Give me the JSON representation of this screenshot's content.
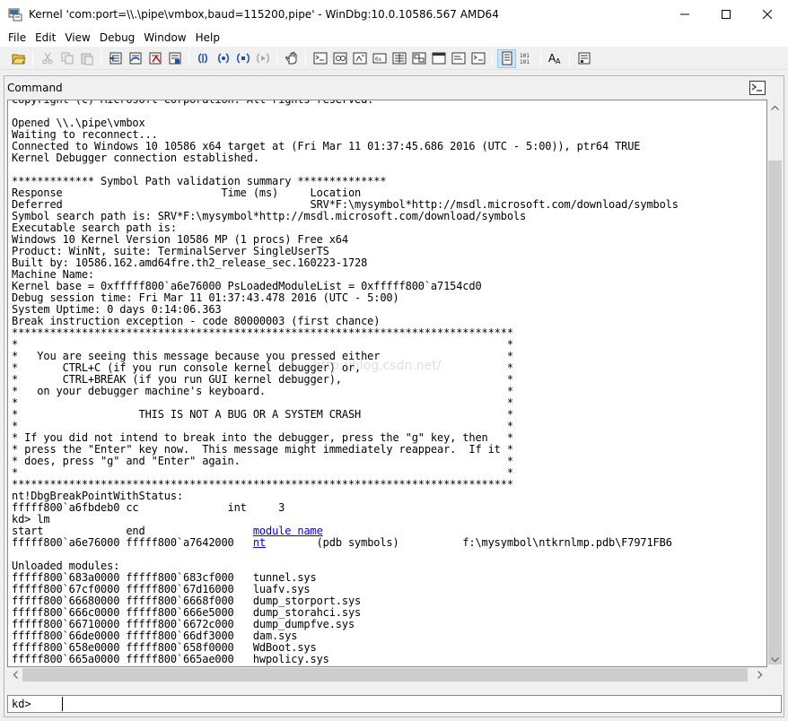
{
  "window": {
    "title": "Kernel 'com:port=\\\\.\\pipe\\vmbox,baud=115200,pipe' - WinDbg:10.0.10586.567 AMD64"
  },
  "menu": [
    "File",
    "Edit",
    "View",
    "Debug",
    "Window",
    "Help"
  ],
  "toolbar_icons": [
    "open-icon",
    "cut-icon",
    "copy-icon",
    "paste-icon",
    "step-into-icon",
    "step-over-icon",
    "step-out-icon",
    "run-to-cursor-icon",
    "restart-icon",
    "break-icon",
    "stop-icon",
    "go-icon",
    "hand-icon",
    "command-window-icon",
    "watch-window-icon",
    "locals-window-icon",
    "registers-window-icon",
    "memory-window-icon",
    "call-stack-window-icon",
    "disassembly-window-icon",
    "scratch-pad-icon",
    "processes-threads-icon",
    "source-mode-icon",
    "hex-mode-icon",
    "font-icon",
    "options-icon"
  ],
  "command_window": {
    "title": "Command",
    "lines": [
      "Copyright (c) Microsoft Corporation. All rights reserved.",
      "",
      "Opened \\\\.\\pipe\\vmbox",
      "Waiting to reconnect...",
      "Connected to Windows 10 10586 x64 target at (Fri Mar 11 01:37:45.686 2016 (UTC - 5:00)), ptr64 TRUE",
      "Kernel Debugger connection established.",
      "",
      "************* Symbol Path validation summary **************",
      "Response                         Time (ms)     Location",
      "Deferred                                       SRV*F:\\mysymbol*http://msdl.microsoft.com/download/symbols",
      "Symbol search path is: SRV*F:\\mysymbol*http://msdl.microsoft.com/download/symbols",
      "Executable search path is:",
      "Windows 10 Kernel Version 10586 MP (1 procs) Free x64",
      "Product: WinNt, suite: TerminalServer SingleUserTS",
      "Built by: 10586.162.amd64fre.th2_release_sec.160223-1728",
      "Machine Name:",
      "Kernel base = 0xfffff800`a6e76000 PsLoadedModuleList = 0xfffff800`a7154cd0",
      "Debug session time: Fri Mar 11 01:37:43.478 2016 (UTC - 5:00)",
      "System Uptime: 0 days 0:14:06.363",
      "Break instruction exception - code 80000003 (first chance)",
      "*******************************************************************************",
      "*                                                                             *",
      "*   You are seeing this message because you pressed either                    *",
      "*       CTRL+C (if you run console kernel debugger) or,                       *",
      "*       CTRL+BREAK (if you run GUI kernel debugger),                          *",
      "*   on your debugger machine's keyboard.                                      *",
      "*                                                                             *",
      "*                   THIS IS NOT A BUG OR A SYSTEM CRASH                       *",
      "*                                                                             *",
      "* If you did not intend to break into the debugger, press the \"g\" key, then   *",
      "* press the \"Enter\" key now.  This message might immediately reappear.  If it *",
      "* does, press \"g\" and \"Enter\" again.                                          *",
      "*                                                                             *",
      "*******************************************************************************",
      "nt!DbgBreakPointWithStatus:",
      "fffff800`a6fbdeb0 cc              int     3",
      "kd> lm",
      "start             end                 "
    ],
    "lm_header_link": "module name",
    "lm_row_prefix": "fffff800`a6e76000 fffff800`a7642000   ",
    "lm_row_link": "nt",
    "lm_row_suffix": "        (pdb symbols)          f:\\mysymbol\\ntkrnlmp.pdb\\F7971FB6",
    "lines_after": [
      "",
      "Unloaded modules:",
      "fffff800`683a0000 fffff800`683cf000   tunnel.sys",
      "fffff800`67cf0000 fffff800`67d16000   luafv.sys",
      "fffff800`66680000 fffff800`6668f000   dump_storport.sys",
      "fffff800`666c0000 fffff800`666e5000   dump_storahci.sys",
      "fffff800`66710000 fffff800`6672c000   dump_dumpfve.sys",
      "fffff800`66de0000 fffff800`66df3000   dam.sys",
      "fffff800`658e0000 fffff800`658f0000   WdBoot.sys",
      "fffff800`665a0000 fffff800`665ae000   hwpolicy.sys"
    ],
    "watermark": "http://blog.csdn.net/",
    "input_prompt": "kd>",
    "input_value": ""
  }
}
